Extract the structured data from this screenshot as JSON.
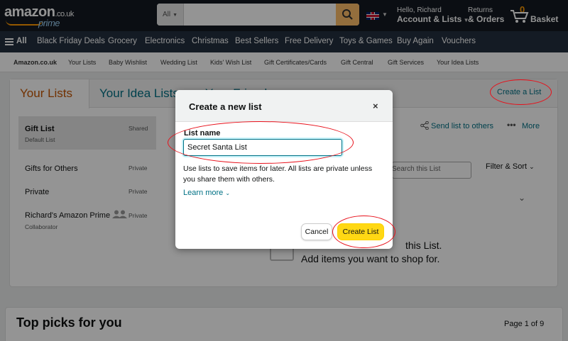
{
  "header": {
    "logo_text": "amazon",
    "logo_domain": ".co.uk",
    "logo_prime": "prime",
    "search_dept": "All",
    "greeting": "Hello, Richard",
    "account_label": "Account & Lists",
    "returns_small": "Returns",
    "returns_bold": "& Orders",
    "basket_count": "0",
    "basket_label": "Basket"
  },
  "nav": {
    "items": [
      "All",
      "Black Friday Deals",
      "Grocery",
      "Electronics",
      "Christmas",
      "Best Sellers",
      "Free Delivery",
      "Toys & Games",
      "Buy Again",
      "Vouchers"
    ]
  },
  "subnav": {
    "items": [
      "Amazon.co.uk",
      "Your Lists",
      "Baby Wishlist",
      "Wedding List",
      "Kids' Wish List",
      "Gift Certificates/Cards",
      "Gift Central",
      "Gift Services",
      "Your Idea Lists"
    ]
  },
  "lists_page": {
    "tabs": [
      "Your Lists",
      "Your Idea Lists",
      "Your Friends"
    ],
    "create_list_link": "Create a List",
    "lists": [
      {
        "name": "Gift List",
        "sub": "Default List",
        "privacy": "Shared"
      },
      {
        "name": "Gifts for Others",
        "sub": "",
        "privacy": "Private"
      },
      {
        "name": "Private",
        "sub": "",
        "privacy": "Private"
      },
      {
        "name": "Richard's Amazon Prime",
        "sub": "Collaborator",
        "privacy": "Private"
      }
    ],
    "send_list": "Send list to others",
    "more": "More",
    "search_placeholder": "Search this List",
    "filter_sort": "Filter & Sort",
    "empty_line1": "this List.",
    "empty_line2": "Add items you want to shop for."
  },
  "picks": {
    "title": "Top picks for you",
    "page": "Page 1 of 9"
  },
  "modal": {
    "title": "Create a new list",
    "close": "×",
    "label": "List name",
    "input_value": "Secret Santa List",
    "help_text": "Use lists to save items for later. All lists are private unless you share them with others.",
    "learn_more": "Learn more",
    "cancel": "Cancel",
    "create": "Create List"
  }
}
